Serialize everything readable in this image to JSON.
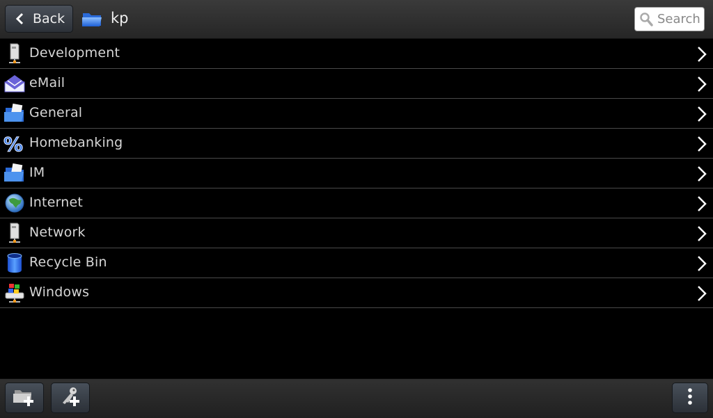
{
  "header": {
    "back_label": "Back",
    "back_icon": "chevron-left-icon",
    "folder_icon": "folder-icon",
    "title": "kp",
    "search_placeholder": "Search",
    "search_icon": "search-icon"
  },
  "groups": [
    {
      "label": "Development",
      "icon": "network-server-icon"
    },
    {
      "label": "eMail",
      "icon": "mail-envelope-icon"
    },
    {
      "label": "General",
      "icon": "folder-open-icon"
    },
    {
      "label": "Homebanking",
      "icon": "percent-icon"
    },
    {
      "label": "IM",
      "icon": "folder-open-icon"
    },
    {
      "label": "Internet",
      "icon": "globe-icon"
    },
    {
      "label": "Network",
      "icon": "network-server-icon"
    },
    {
      "label": "Recycle Bin",
      "icon": "recycle-bin-icon"
    },
    {
      "label": "Windows",
      "icon": "windows-drive-icon"
    }
  ],
  "toolbar": {
    "add_group_icon": "add-folder-icon",
    "add_entry_icon": "add-key-icon",
    "menu_icon": "overflow-menu-icon"
  }
}
